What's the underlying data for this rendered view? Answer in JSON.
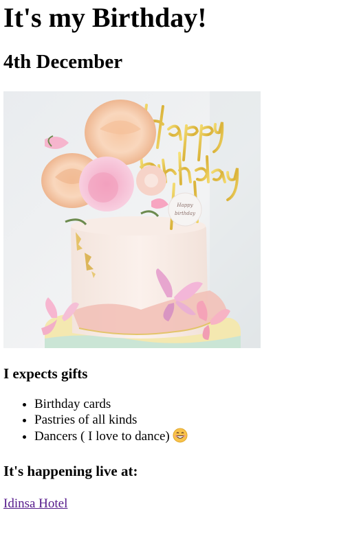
{
  "page": {
    "title": "It's my Birthday!",
    "date": "4th December"
  },
  "image": {
    "alt": "Birthday cake decorated with flowers, butterflies and a Happy Birthday topper",
    "topper_text": "Happy Birthday",
    "disc_text_line1": "Happy",
    "disc_text_line2": "birthday"
  },
  "gifts": {
    "heading": "I expects gifts",
    "items": [
      {
        "label": "Birthday cards"
      },
      {
        "label": "Pastries of all kinds"
      },
      {
        "label": "Dancers ( I love to dance)",
        "emoji": "grinning-face-icon"
      }
    ]
  },
  "venue": {
    "heading": "It's happening live at:",
    "link_text": "Idinsa Hotel",
    "link_color": "#551a8b"
  },
  "colors": {
    "background": "#ffffff",
    "text": "#000000",
    "visited_link": "#551a8b"
  }
}
